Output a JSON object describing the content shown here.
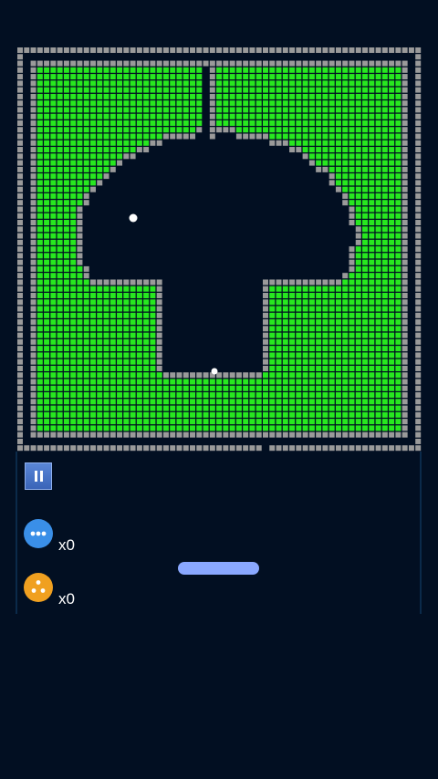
{
  "powerups": {
    "multiball": {
      "icon": "multiball-icon",
      "count": "x0",
      "color": "#3a8fe8"
    },
    "split": {
      "icon": "split-ball-icon",
      "count": "x0",
      "color": "#f0a020"
    }
  },
  "colors": {
    "background": "#020f22",
    "wall_brick": "#9a9a9a",
    "green_brick": "#27e81f",
    "paddle": "#8aa8ff",
    "ball": "#ffffff"
  }
}
